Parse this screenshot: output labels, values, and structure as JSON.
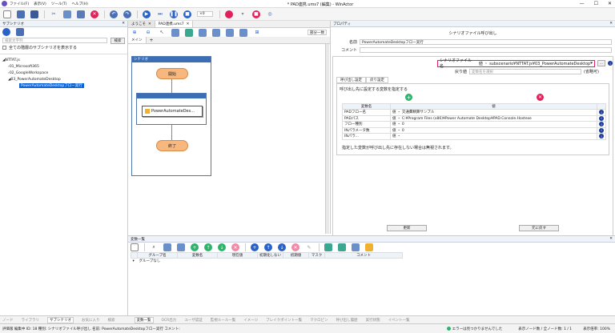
{
  "titlebar": {
    "menus": [
      "ファイル(F)",
      "表示(V)",
      "ツール(T)",
      "ヘルプ(H)"
    ],
    "title": "* PAD連携.ums7 (編集) - WinActor"
  },
  "toolbar": {
    "stepper_value": "×0"
  },
  "left": {
    "header": "サブシナリオ",
    "search_placeholder": "検索文字列",
    "search_button": "検索",
    "show_all_label": "全ての階層のサブシナリオを表示する",
    "tree": [
      "NTTAT.js",
      "01_Microsoft365",
      "02_GoogleWorkspace",
      "03_PowerAutomateDesktop",
      "PowerAutomateDesktopフロー実行"
    ]
  },
  "center": {
    "tabs": [
      "ようこそ",
      "PAD連携.ums7"
    ],
    "sub_tabs": [
      "メイン"
    ],
    "group_select": "部分一致",
    "flow_title": "シナリオ",
    "node_start": "開始",
    "node_action": "PowerAutomateDes...",
    "node_end": "終了"
  },
  "right": {
    "header": "プロパティ",
    "panel_title": "シナリオファイル呼び出し",
    "name_label": "名前",
    "name_value": "PowerAutomateDesktopフロー実行",
    "comment_label": "コメント",
    "scenario_file_label": "シナリオファイル名",
    "scenario_file_value": "値 ・ subscenario¥NTTAT.js¥03_PowerAutomateDesktop¥Pov",
    "return_label": "戻り値",
    "return_placeholder": "変数名を選択",
    "return_note": "(省略可)",
    "sub_tabs": [
      "呼び出し設定",
      "戻り設定"
    ],
    "instruction": "呼び出し先に設定する変数を指定する",
    "col_var": "変数名",
    "col_val": "値",
    "rows": [
      {
        "name": "PADフロー名",
        "value": "値 ・ 交通費精算サンプル"
      },
      {
        "name": "PADパス",
        "value": "値 ・ C:¥Program Files (x86)¥Power Automate Desktop¥PAD.Console.Hostexe"
      },
      {
        "name": "フロー種別",
        "value": "値 ・ 0"
      },
      {
        "name": "INパラメータ数",
        "value": "値 ・ 0"
      },
      {
        "name": "INパラ...",
        "value": "値 ・ "
      }
    ],
    "warning": "指定した変数が呼び出し先に存在しない場合は無視されます。",
    "update_button": "更新",
    "restore_button": "元に戻す"
  },
  "bottom": {
    "header": "変数一覧",
    "columns": [
      "グループ名",
      "変数名",
      "現在値",
      "初期化しない",
      "初期値",
      "マスク",
      "コメント"
    ],
    "group_row": "グループなし"
  },
  "bottom_tabs": [
    "ノード",
    "ライブラリ",
    "サブシナリオ",
    "お気に入り",
    "検索",
    "変数一覧",
    "OCR出力",
    "ユーザ認証",
    "監視ルール一覧",
    "イメージ",
    "ブレイクポイント一覧",
    "マクロピン",
    "呼び出し履歴",
    "実行状態",
    "イベント一覧"
  ],
  "statusbar": {
    "left": "評価版 編集中  ID: 18 種別: シナリオファイル呼び出し 名前: PowerAutomateDesktopフロー実行 コメント:",
    "error": "エラーは見つかりませんでした",
    "nodes": "表示ノード数 / 全ノード数: 1 / 1",
    "zoom": "表示倍率: 100%"
  },
  "colors": {
    "accent": "#0a64d8",
    "record": "#e0215a",
    "node": "#f8b77d"
  }
}
